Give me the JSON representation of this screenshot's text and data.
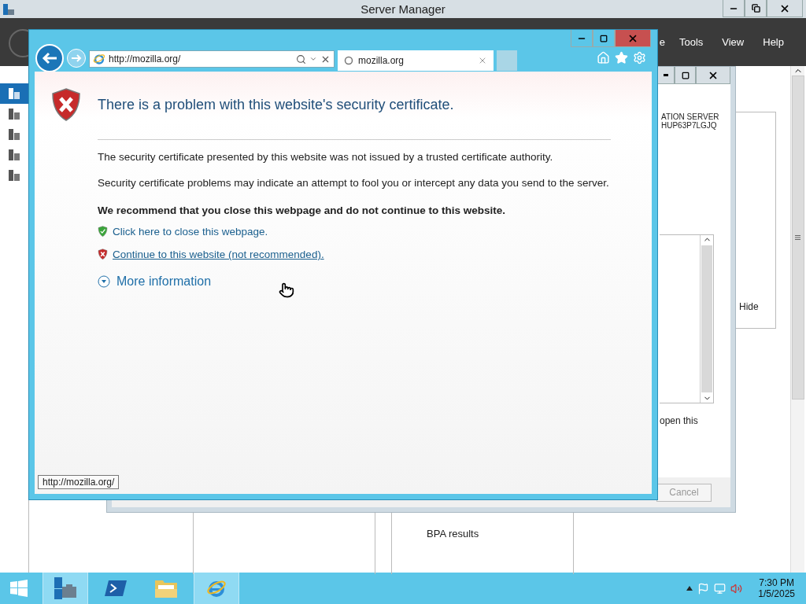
{
  "server_manager": {
    "title": "Server Manager",
    "menu": [
      "e",
      "Tools",
      "View",
      "Help"
    ],
    "sidebar_items": [
      {
        "selected": true
      },
      {
        "selected": false
      },
      {
        "selected": false
      },
      {
        "selected": false
      },
      {
        "selected": false
      }
    ],
    "hide_label": "Hide",
    "tile_text": "BPA results"
  },
  "dialog": {
    "lines": [
      "ATION SERVER",
      "HUP63P7LGJQ"
    ],
    "note": "open this",
    "cancel_button": "Cancel"
  },
  "browser": {
    "address": "http://mozilla.org/",
    "tab": {
      "title": "mozilla.org",
      "loading": true
    },
    "page": {
      "heading": "There is a problem with this website's security certificate.",
      "paragraphs": [
        "The security certificate presented by this website was not issued by a trusted certificate authority.",
        "Security certificate problems may indicate an attempt to fool you or intercept any data you send to the server."
      ],
      "recommendation": "We recommend that you close this webpage and do not continue to this website.",
      "links": [
        {
          "kind": "safe",
          "text": "Click here to close this webpage.",
          "underlined": false
        },
        {
          "kind": "unsafe",
          "text": "Continue to this website (not recommended).",
          "underlined": true
        }
      ],
      "more_info": "More information"
    },
    "status_url": "http://mozilla.org/"
  },
  "taskbar": {
    "apps": [
      {
        "kind": "server",
        "highlighted": true
      },
      {
        "kind": "shell",
        "highlighted": false
      },
      {
        "kind": "folder",
        "highlighted": false
      },
      {
        "kind": "browser",
        "highlighted": true
      }
    ],
    "time": "7:30 PM",
    "date": "1/5/2025"
  }
}
